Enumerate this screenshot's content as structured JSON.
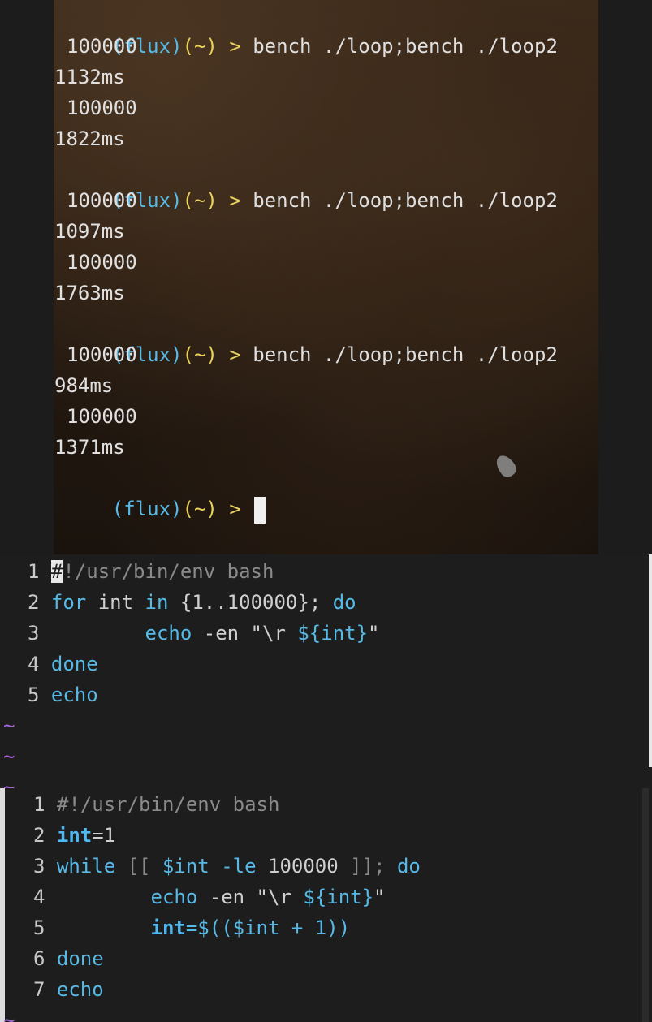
{
  "terminal": {
    "prompt": {
      "env": "(flux)",
      "dir": "(~)",
      "arrow": ">"
    },
    "command": "bench ./loop;bench ./loop2",
    "runs": [
      {
        "count1": "100000",
        "time1": "1132ms",
        "count2": "100000",
        "time2": "1822ms"
      },
      {
        "count1": "100000",
        "time1": "1097ms",
        "count2": "100000",
        "time2": "1763ms"
      },
      {
        "count1": "100000",
        "time1": "984ms",
        "count2": "100000",
        "time2": "1371ms"
      }
    ]
  },
  "editor_top": {
    "lines": [
      {
        "n": "1",
        "hash": "#",
        "rest": "!/usr/bin/env bash"
      },
      {
        "n": "2",
        "kw_for": "for",
        "var": " int ",
        "kw_in": "in",
        "range": " {1..100000}; ",
        "kw_do": "do"
      },
      {
        "n": "3",
        "indent": "        ",
        "cmd": "echo",
        "arg": " -en \"\\r ",
        "varref": "${int}",
        "quote": "\""
      },
      {
        "n": "4",
        "text": "done"
      },
      {
        "n": "5",
        "text": "echo"
      }
    ],
    "tilde": "~"
  },
  "editor_bottom": {
    "lines": [
      {
        "n": "1",
        "text": "#!/usr/bin/env bash"
      },
      {
        "n": "2",
        "var": "int",
        "rest": "=1"
      },
      {
        "n": "3",
        "kw_while": "while",
        "open": " [[ ",
        "varref": "$int",
        "op": " -le ",
        "num": "100000",
        "close": " ]]; ",
        "kw_do": "do"
      },
      {
        "n": "4",
        "indent": "        ",
        "cmd": "echo",
        "arg": " -en \"\\r ",
        "varref": "${int}",
        "quote": "\""
      },
      {
        "n": "5",
        "indent": "        ",
        "var": "int",
        "eq": "=$((",
        "varref": "$int",
        "op": " + 1))"
      },
      {
        "n": "6",
        "text": "done"
      },
      {
        "n": "7",
        "text": "echo"
      }
    ],
    "tilde": "~"
  }
}
